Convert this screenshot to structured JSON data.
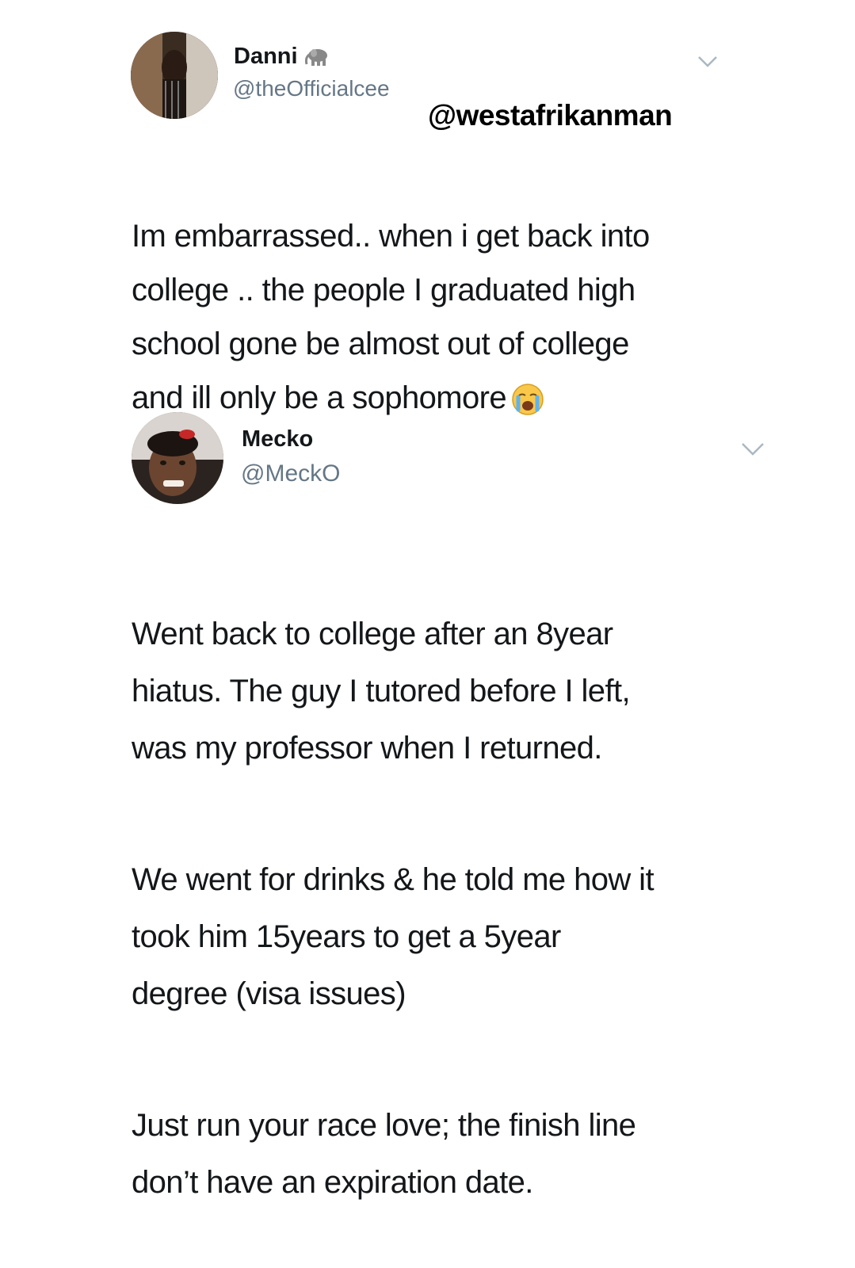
{
  "tweets": [
    {
      "author_name": "Danni",
      "author_handle": "@theOfficialcee",
      "name_emoji_icon": "elephant-icon",
      "mention_overlay": "@westafrikanman",
      "text": "Im embarrassed.. when i get back into\ncollege .. the people I graduated high\nschool gone be almost out of college\nand ill only be a sophomore",
      "trailing_emoji_icon": "crying-face-icon"
    },
    {
      "author_name": "Mecko",
      "author_handle": "@MeckO",
      "paragraphs": [
        "Went back to college after an 8year\nhiatus. The guy I tutored before I left,\nwas my professor when I returned.",
        "We went for drinks & he told me how it\ntook him 15years to get a 5year\ndegree (visa issues)",
        "Just run your race love; the finish line\ndon’t have an expiration date."
      ]
    }
  ],
  "colors": {
    "text": "#14171a",
    "secondary": "#657786",
    "chevron": "#aab8c2"
  }
}
